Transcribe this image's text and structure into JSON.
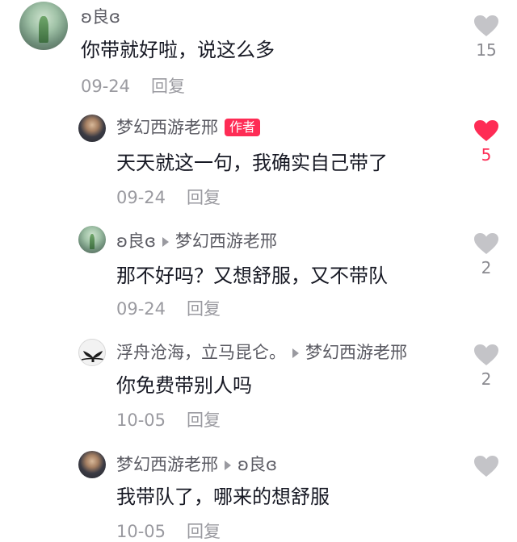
{
  "comments": [
    {
      "username": "ʚ良ɞ",
      "text": "你带就好啦，说这么多",
      "date": "09-24",
      "reply_label": "回复",
      "likes": "15",
      "liked": false
    },
    {
      "username": "梦幻西游老邢",
      "author_tag": "作者",
      "text": "天天就这一句，我确实自己带了",
      "date": "09-24",
      "reply_label": "回复",
      "likes": "5",
      "liked": true
    },
    {
      "username": "ʚ良ɞ",
      "reply_to": "梦幻西游老邢",
      "text": "那不好吗？又想舒服，又不带队",
      "date": "09-24",
      "reply_label": "回复",
      "likes": "2",
      "liked": false
    },
    {
      "username": "浮舟沧海，立马昆仑。",
      "reply_to": "梦幻西游老邢",
      "text": "你免费带别人吗",
      "date": "10-05",
      "reply_label": "回复",
      "likes": "2",
      "liked": false
    },
    {
      "username": "梦幻西游老邢",
      "reply_to": "ʚ良ɞ",
      "text": "我带队了，哪来的想舒服",
      "date": "10-05",
      "reply_label": "回复",
      "likes": "",
      "liked": false
    }
  ],
  "colors": {
    "accent": "#fe2c55",
    "heart_inactive": "#c4c4c8",
    "meta_text": "#9a9aa0"
  },
  "icons": {
    "like": "heart-icon",
    "reply_arrow": "triangle-right-icon"
  }
}
